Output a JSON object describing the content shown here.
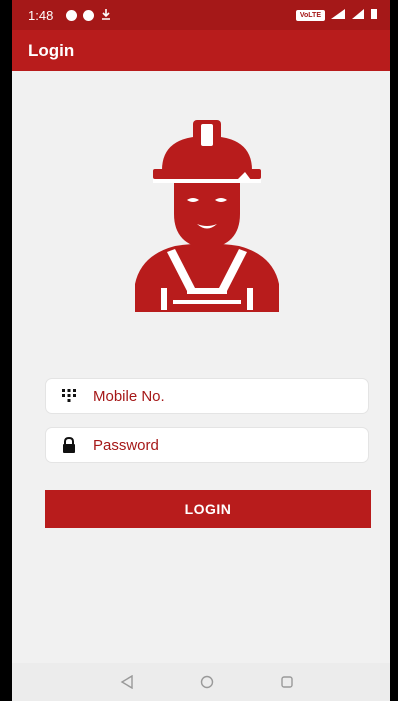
{
  "status_bar": {
    "time": "1:48",
    "network_badge": "VoLTE",
    "icons": [
      "message-icon",
      "chrome-icon",
      "download-icon",
      "volte-icon",
      "signal-icon",
      "battery-icon"
    ]
  },
  "app_bar": {
    "title": "Login"
  },
  "form": {
    "mobile_placeholder": "Mobile No.",
    "password_placeholder": "Password",
    "login_label": "LOGIN"
  },
  "nav_bar": {
    "buttons": [
      "back-icon",
      "home-icon",
      "recents-icon"
    ]
  },
  "colors": {
    "primary": "#b81c1c",
    "primary_dark": "#a51818",
    "background": "#f1f1f1",
    "input_background": "#ffffff"
  }
}
